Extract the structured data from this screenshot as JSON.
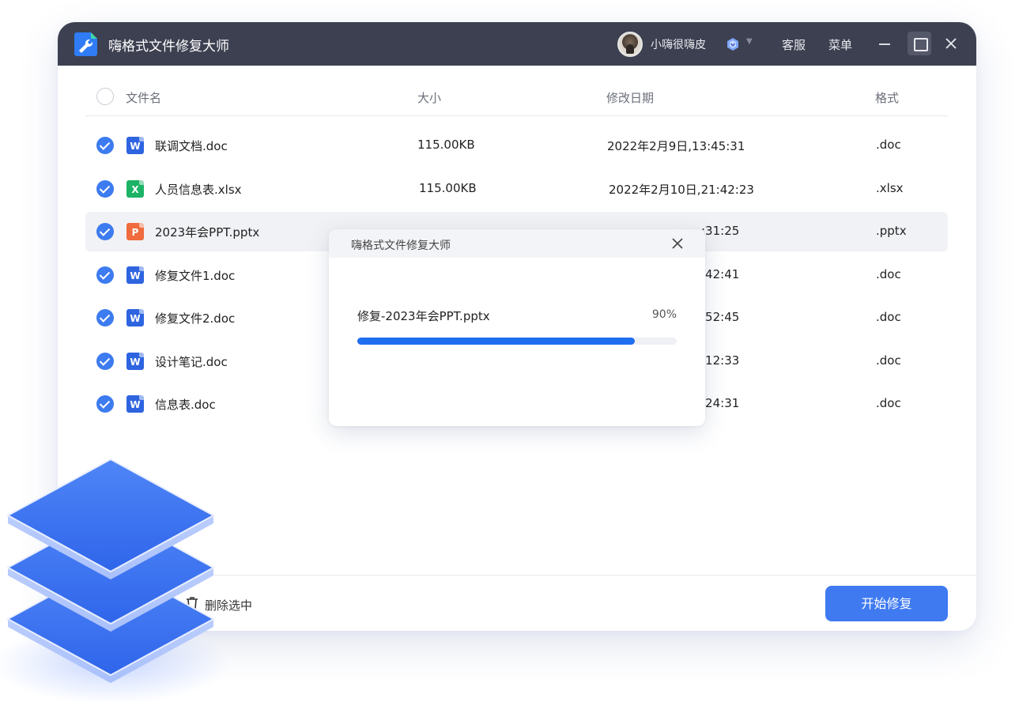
{
  "app": {
    "title": "嗨格式文件修复大师",
    "username": "小嗨很嗨皮",
    "service_label": "客服",
    "menu_label": "菜单"
  },
  "table": {
    "columns": [
      "文件名",
      "大小",
      "修改日期",
      "格式"
    ],
    "rows": [
      {
        "name": "联调文档.doc",
        "size": "115.00KB",
        "date": "2022年2月9日,13:45:31",
        "format": ".doc",
        "icon": "word-icon",
        "icon_letter": "W",
        "checked": true
      },
      {
        "name": "人员信息表.xlsx",
        "size": "115.00KB",
        "date": "2022年2月10日,21:42:23",
        "format": ".xlsx",
        "icon": "excel-icon",
        "icon_letter": "X",
        "checked": true
      },
      {
        "name": "2023年会PPT.pptx",
        "size": "",
        "date": ":31:25",
        "format": ".pptx",
        "icon": "ppt-icon",
        "icon_letter": "P",
        "checked": true
      },
      {
        "name": "修复文件1.doc",
        "size": "",
        "date": ":42:41",
        "format": ".doc",
        "icon": "word-icon",
        "icon_letter": "W",
        "checked": true
      },
      {
        "name": "修复文件2.doc",
        "size": "",
        "date": ":52:45",
        "format": ".doc",
        "icon": "word-icon",
        "icon_letter": "W",
        "checked": true
      },
      {
        "name": "设计笔记.doc",
        "size": "",
        "date": ":12:33",
        "format": ".doc",
        "icon": "word-icon",
        "icon_letter": "W",
        "checked": true
      },
      {
        "name": "信息表.doc",
        "size": "",
        "date": ":24:31",
        "format": ".doc",
        "icon": "word-icon",
        "icon_letter": "W",
        "checked": true
      }
    ]
  },
  "footer": {
    "delete_label": "删除选中",
    "start_label": "开始修复"
  },
  "dialog": {
    "title": "嗨格式文件修复大师",
    "file_label": "修复-2023年会PPT.pptx",
    "percent_label": "90%",
    "progress": 0.87
  },
  "colors": {
    "titlebar": "#3d4050",
    "accent": "#3f7af1",
    "progress": "#1f6ef0"
  }
}
